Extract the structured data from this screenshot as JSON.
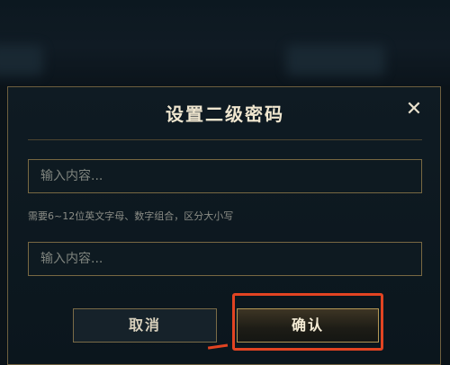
{
  "dialog": {
    "title": "设置二级密码",
    "close_glyph": "✕",
    "password_placeholder": "输入内容...",
    "confirm_placeholder": "输入内容...",
    "hint": "需要6~12位英文字母、数字组合，区分大小写",
    "cancel_label": "取消",
    "confirm_label": "确认"
  },
  "colors": {
    "accent_gold": "#b39655",
    "highlight_red": "#e24422",
    "text_light": "#efe6cf"
  },
  "icons": [
    "close-icon"
  ]
}
